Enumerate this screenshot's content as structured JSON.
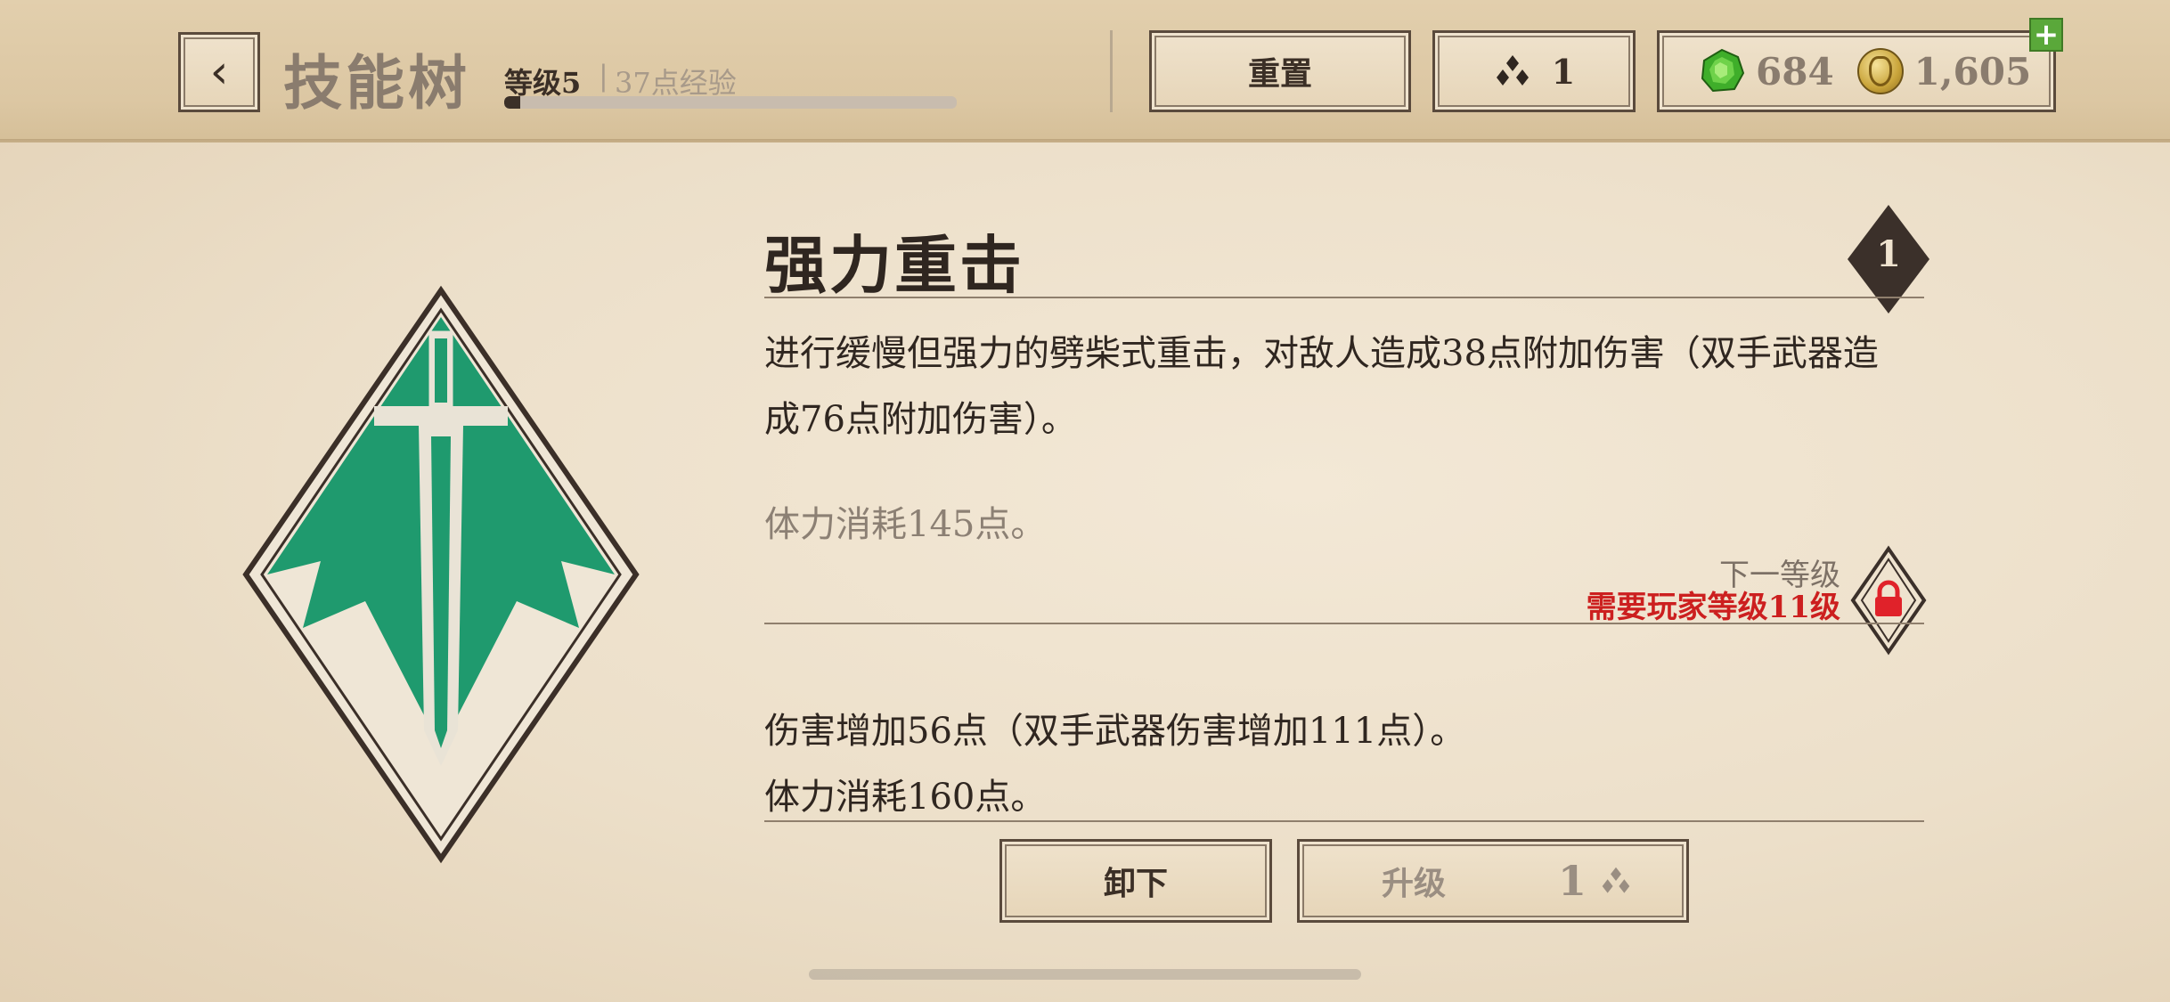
{
  "header": {
    "back_icon": "chevron-left-icon",
    "back_glyph": "‹",
    "title": "技能树",
    "level_label": "等级5",
    "separator": "|",
    "xp_label": "37点经验",
    "xp_progress": 0.035,
    "reset_label": "重置",
    "skill_points": "1",
    "skill_points_icon": "triple-diamond-icon",
    "gems": "684",
    "gems_icon": "green-gem-icon",
    "gold": "1,605",
    "gold_icon": "gold-coin-icon",
    "plus_glyph": "+"
  },
  "skill": {
    "emblem_icon": "sword-diamond-icon",
    "name": "强力重击",
    "rank": "1",
    "description": "进行缓慢但强力的劈柴式重击，对敌人造成38点附加伤害（双手武器造成76点附加伤害）。",
    "cost_current": "体力消耗145点。",
    "next_level_label": "下一等级",
    "requirement": "需要玩家等级11级",
    "lock_icon": "lock-icon",
    "next_line1": "伤害增加56点（双手武器伤害增加111点）。",
    "next_line2": "体力消耗160点。"
  },
  "actions": {
    "unequip_label": "卸下",
    "upgrade_label": "升级",
    "upgrade_cost": "1"
  },
  "colors": {
    "accent_green": "#1f9a6e",
    "text_dark": "#2f2620",
    "requirement_red": "#cc1f1f",
    "lock_red": "#e0222a"
  }
}
